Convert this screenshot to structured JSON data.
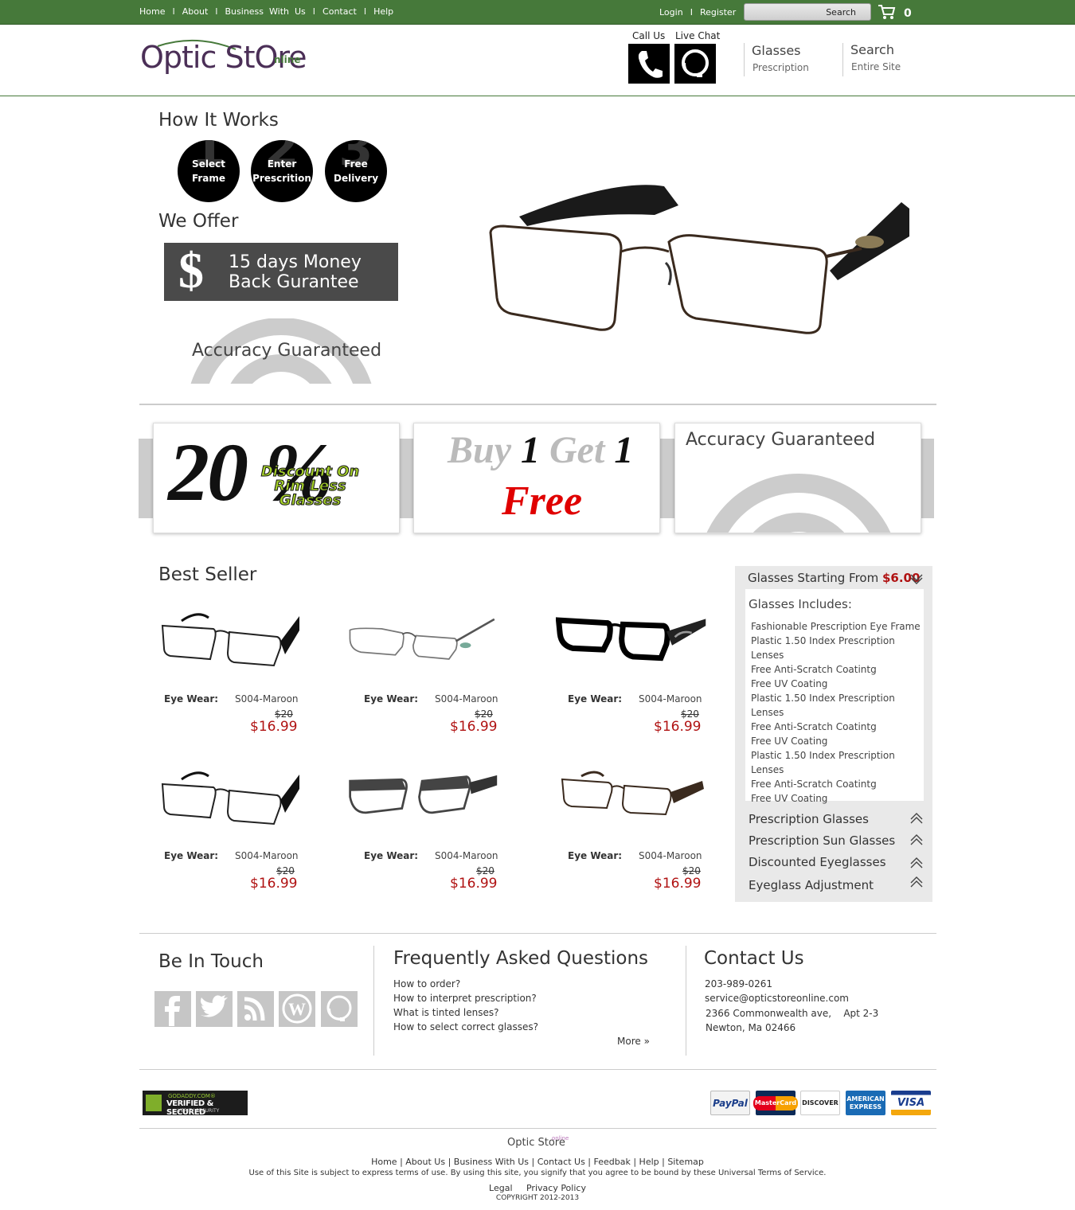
{
  "topnav": {
    "home": "Home",
    "about": "About",
    "business": "Business  With  Us",
    "contact": "Contact",
    "help": "Help",
    "login": "Login",
    "register": "Register",
    "search_label": "Search",
    "cart_count": "0",
    "separator": "I"
  },
  "header": {
    "call_us": "Call Us",
    "live_chat": "Live Chat",
    "glasses": "Glasses",
    "glasses_sub": "Prescription",
    "search": "Search",
    "search_sub": "Entire Site"
  },
  "logo": {
    "text": "Optic StOre",
    "suffix": "nline"
  },
  "how": {
    "title": "How It Works",
    "steps": [
      {
        "num": "1",
        "label1": "Select",
        "label2": "Frame"
      },
      {
        "num": "2",
        "label1": "Enter",
        "label2": "Prescrition"
      },
      {
        "num": "3",
        "label1": "Free",
        "label2": "Delivery"
      }
    ]
  },
  "offer": {
    "title": "We Offer",
    "money_symbol": "$",
    "money_line1": "15 days Money",
    "money_line2": "Back Gurantee",
    "accuracy": "Accuracy Guaranteed"
  },
  "promos": {
    "p1_big": "20 %",
    "p1_tag1": "Discount On",
    "p1_tag2": "Rim Less",
    "p1_tag3": "Glasses",
    "p2_buy": "Buy",
    "p2_one": "1",
    "p2_get": "Get",
    "p2_one2": "1",
    "p2_free": "Free",
    "p3_title": "Accuracy Guaranteed"
  },
  "bestseller": {
    "title": "Best Seller",
    "products": [
      {
        "label": "Eye Wear:",
        "code": "S004-Maroon",
        "old": "$20",
        "price": "$16.99"
      },
      {
        "label": "Eye Wear:",
        "code": "S004-Maroon",
        "old": "$20",
        "price": "$16.99"
      },
      {
        "label": "Eye Wear:",
        "code": "S004-Maroon",
        "old": "$20",
        "price": "$16.99"
      },
      {
        "label": "Eye Wear:",
        "code": "S004-Maroon",
        "old": "$20",
        "price": "$16.99"
      },
      {
        "label": "Eye Wear:",
        "code": "S004-Maroon",
        "old": "$20",
        "price": "$16.99"
      },
      {
        "label": "Eye Wear:",
        "code": "S004-Maroon",
        "old": "$20",
        "price": "$16.99"
      }
    ]
  },
  "sidebar": {
    "head": "Glasses Starting From",
    "head_price": "$6.00",
    "includes_title": "Glasses Includes:",
    "includes": [
      "Fashionable Prescription Eye Frame",
      "Plastic 1.50 Index Prescription Lenses",
      "Free Anti-Scratch Coatintg",
      "Free UV Coating",
      "Plastic 1.50 Index Prescription Lenses",
      "Free Anti-Scratch Coatintg",
      "Free UV Coating",
      "Plastic 1.50 Index Prescription Lenses",
      "Free Anti-Scratch Coatintg",
      "Free UV Coating"
    ],
    "categories": [
      "Prescription Glasses",
      "Prescription Sun Glasses",
      "Discounted Eyeglasses",
      "Eyeglass Adjustment"
    ]
  },
  "touch": {
    "title": "Be In Touch",
    "icons": [
      "facebook-icon",
      "twitter-icon",
      "rss-icon",
      "wordpress-icon",
      "live-chat-icon"
    ]
  },
  "faq": {
    "title": "Frequently Asked Questions",
    "items": [
      "How to order?",
      "How to interpret prescription?",
      "What is tinted lenses?",
      "How to select correct glasses?"
    ],
    "more": "More"
  },
  "contact": {
    "title": "Contact Us",
    "phone": "203-989-0261",
    "email": "service@opticstoreonline.com",
    "address1": "2366 Commonwealth ave,    Apt 2-3",
    "address2": "Newton, Ma 02466"
  },
  "security": {
    "line1": "GODADDY.COM®",
    "line2": "VERIFIED & SECURED",
    "line3": "VERIFY SECURITY"
  },
  "payments": [
    "PayPal",
    "MasterCard",
    "DISCOVER",
    "AMERICAN EXPRESS",
    "VISA"
  ],
  "footer": {
    "logo": "Optic Store",
    "logo_sup": "online",
    "links": "Home | About Us | Business With Us | Contact Us | Feedbak | Help | Sitemap",
    "terms": "Use of this Site is subject to express terms of use. By using this site, you signify that you agree to be bound by these Universal Terms of Service.",
    "legal": "Legal     Privacy Policy",
    "copyright": "COPYRIGHT 2012-2013"
  },
  "colors": {
    "brand_green": "#46793a",
    "price_red": "#b01212",
    "free_red": "#e00000",
    "tag_green": "#a6d12a"
  }
}
